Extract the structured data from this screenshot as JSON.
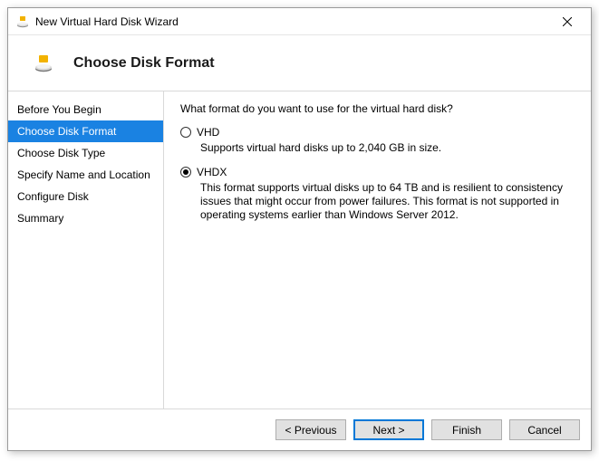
{
  "window": {
    "title": "New Virtual Hard Disk Wizard"
  },
  "header": {
    "title": "Choose Disk Format"
  },
  "sidebar": {
    "items": [
      {
        "label": "Before You Begin",
        "active": false
      },
      {
        "label": "Choose Disk Format",
        "active": true
      },
      {
        "label": "Choose Disk Type",
        "active": false
      },
      {
        "label": "Specify Name and Location",
        "active": false
      },
      {
        "label": "Configure Disk",
        "active": false
      },
      {
        "label": "Summary",
        "active": false
      }
    ]
  },
  "content": {
    "prompt": "What format do you want to use for the virtual hard disk?",
    "options": [
      {
        "key": "vhd",
        "label": "VHD",
        "description": "Supports virtual hard disks up to 2,040 GB in size.",
        "checked": false
      },
      {
        "key": "vhdx",
        "label": "VHDX",
        "description": "This format supports virtual disks up to 64 TB and is resilient to consistency issues that might occur from power failures. This format is not supported in operating systems earlier than Windows Server 2012.",
        "checked": true
      }
    ]
  },
  "footer": {
    "previous": "< Previous",
    "next": "Next >",
    "finish": "Finish",
    "cancel": "Cancel"
  }
}
